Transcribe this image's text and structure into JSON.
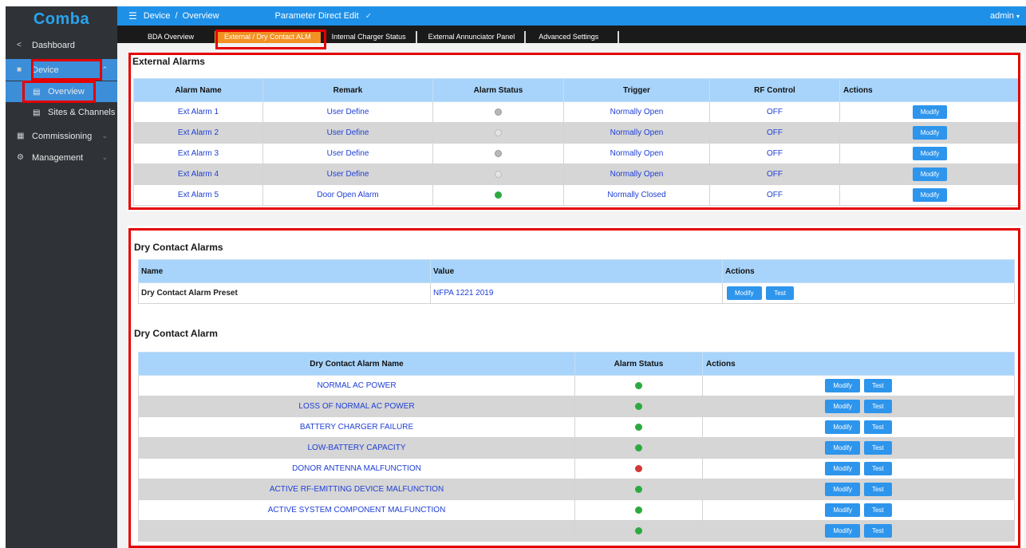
{
  "app": {
    "logo": "Comba",
    "user": "admin"
  },
  "sidebar": {
    "items": [
      {
        "label": "Dashboard",
        "icon": "share-icon"
      },
      {
        "label": "Device",
        "icon": "monitor-icon"
      },
      {
        "label": "Overview",
        "icon": "document-icon"
      },
      {
        "label": "Sites & Channels",
        "icon": "document-icon"
      },
      {
        "label": "Commissioning",
        "icon": "grid-icon"
      },
      {
        "label": "Management",
        "icon": "gear-icon"
      }
    ]
  },
  "header": {
    "breadcrumb": "Device  /  Overview",
    "parameter_direct_edit": "Parameter Direct Edit"
  },
  "tabs": [
    "BDA Overview",
    "External / Dry Contact ALM",
    "Internal Charger Status",
    "External Annunciator Panel",
    "Advanced Settings"
  ],
  "external_alarms": {
    "title": "External Alarms",
    "columns": [
      "Alarm Name",
      "Remark",
      "Alarm Status",
      "Trigger",
      "RF Control",
      "Actions"
    ],
    "rows": [
      {
        "name": "Ext Alarm 1",
        "remark": "User Define",
        "status": "gray",
        "trigger": "Normally Open",
        "rf": "OFF",
        "action": "Modify"
      },
      {
        "name": "Ext Alarm 2",
        "remark": "User Define",
        "status": "empty",
        "trigger": "Normally Open",
        "rf": "OFF",
        "action": "Modify"
      },
      {
        "name": "Ext Alarm 3",
        "remark": "User Define",
        "status": "gray",
        "trigger": "Normally Open",
        "rf": "OFF",
        "action": "Modify"
      },
      {
        "name": "Ext Alarm 4",
        "remark": "User Define",
        "status": "empty",
        "trigger": "Normally Open",
        "rf": "OFF",
        "action": "Modify"
      },
      {
        "name": "Ext Alarm 5",
        "remark": "Door Open Alarm",
        "status": "green",
        "trigger": "Normally Closed",
        "rf": "OFF",
        "action": "Modify"
      }
    ]
  },
  "dry_contact_alarms": {
    "title": "Dry Contact Alarms",
    "columns": [
      "Name",
      "Value",
      "Actions"
    ],
    "row": {
      "name": "Dry Contact Alarm Preset",
      "value": "NFPA 1221 2019",
      "modify": "Modify",
      "test": "Test"
    }
  },
  "dry_contact_alarm": {
    "title": "Dry Contact Alarm",
    "columns": [
      "Dry Contact Alarm Name",
      "Alarm Status",
      "Actions"
    ],
    "modify": "Modify",
    "test": "Test",
    "rows": [
      {
        "name": "NORMAL AC POWER",
        "status": "green"
      },
      {
        "name": "LOSS OF NORMAL AC POWER",
        "status": "green"
      },
      {
        "name": "BATTERY CHARGER FAILURE",
        "status": "green"
      },
      {
        "name": "LOW-BATTERY CAPACITY",
        "status": "green"
      },
      {
        "name": "DONOR ANTENNA MALFUNCTION",
        "status": "red"
      },
      {
        "name": "ACTIVE RF-EMITTING DEVICE MALFUNCTION",
        "status": "green"
      },
      {
        "name": "ACTIVE SYSTEM COMPONENT MALFUNCTION",
        "status": "green"
      },
      {
        "name": "",
        "status": "green"
      }
    ]
  }
}
